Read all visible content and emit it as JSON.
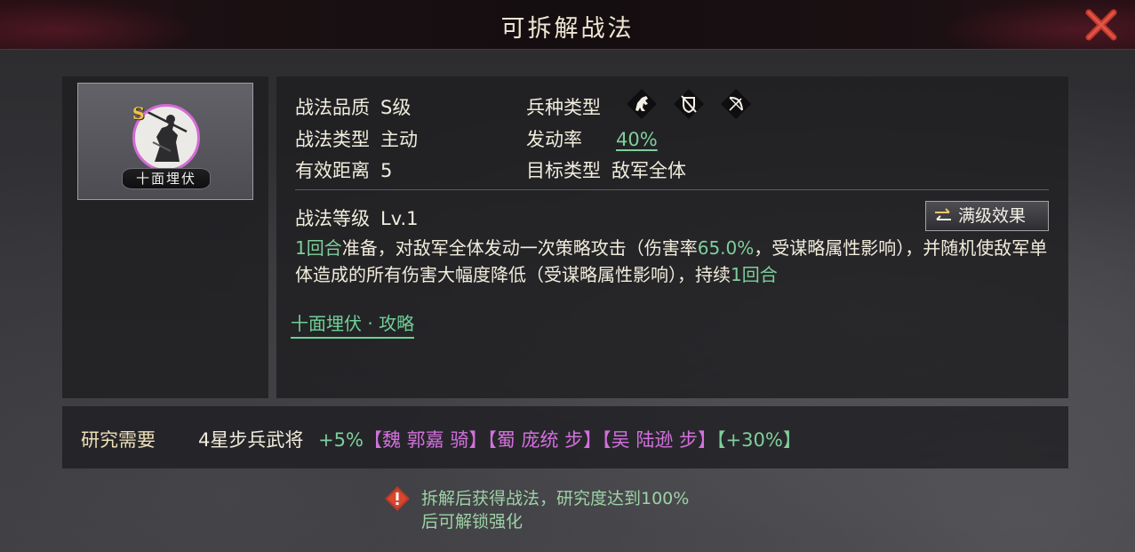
{
  "window": {
    "title": "可拆解战法",
    "close_icon": "close-x-icon",
    "accent_color": "#c0392b"
  },
  "skill_card": {
    "grade": "S",
    "name": "十面埋伏",
    "ring_color": "#d36ad6"
  },
  "attributes": {
    "quality_label": "战法品质",
    "quality_value": "S级",
    "type_label": "战法类型",
    "type_value": "主动",
    "range_label": "有效距离",
    "range_value": "5",
    "troop_label": "兵种类型",
    "troop_icons": [
      "cavalry-icon",
      "infantry-icon",
      "archer-icon"
    ],
    "rate_label": "发动率",
    "rate_value": "40%",
    "target_label": "目标类型",
    "target_value": "敌军全体"
  },
  "level": {
    "label": "战法等级",
    "value": "Lv.1",
    "max_button_label": "满级效果"
  },
  "description": {
    "p1": "1回合",
    "p2": "准备，对敌军全体发动一次策略攻击（伤害率",
    "p3": "65.0%",
    "p4": "，受谋略属性影响），并随机使敌军单体造成的所有伤害大幅度降低（受谋略属性影响），持续",
    "p5": "1回合"
  },
  "guide_link": "十面埋伏 · 攻略",
  "research": {
    "label": "研究需要",
    "base": "4星步兵武将",
    "bonus1": "+5%",
    "generals": "【魏 郭嘉 骑】【蜀 庞统 步】【吴 陆逊 步】",
    "bonus2": "【+30%】"
  },
  "notice": {
    "line1": "拆解后获得战法，研究度达到100%",
    "line2": "后可解锁强化"
  },
  "colors": {
    "highlight_green": "#7fcf9c",
    "general_purple": "#d370dd",
    "research_label": "#eedfb8"
  }
}
